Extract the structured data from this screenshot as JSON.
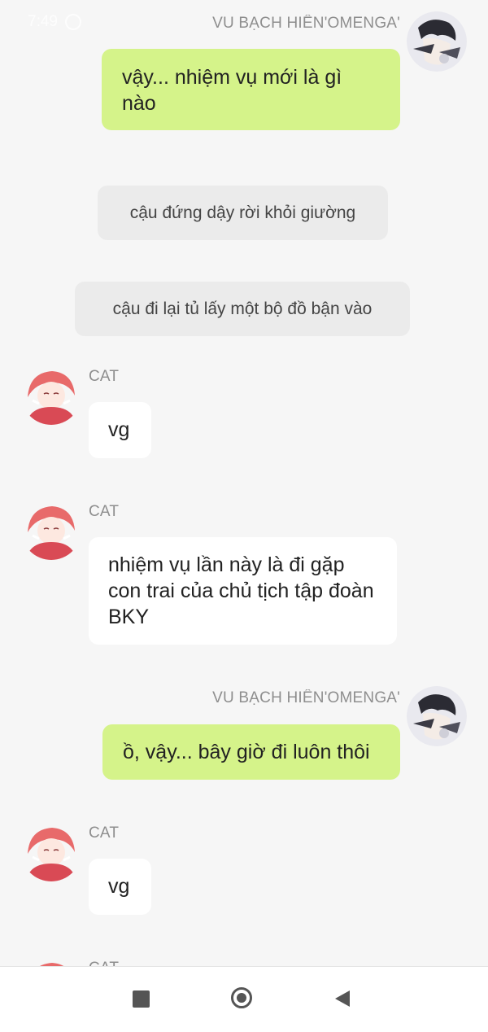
{
  "status_bar": {
    "time": "7:49"
  },
  "messages": {
    "m1": {
      "sender": "VU BẠCH HIÊN'OMENGA'",
      "text": "vậy... nhiệm vụ mới là gì nào"
    },
    "n1": {
      "text": "cậu đứng dậy rời khỏi giường"
    },
    "n2": {
      "text": "cậu đi lại tủ lấy một bộ đồ bận vào"
    },
    "c1": {
      "sender": "CAT",
      "text": "vg"
    },
    "c2": {
      "sender": "CAT",
      "text": "nhiệm vụ lần này là đi gặp con trai của chủ tịch tập đoàn BKY"
    },
    "m2": {
      "sender": "VU BẠCH HIÊN'OMENGA'",
      "text": "ồ, vậy... bây giờ đi luôn thôi"
    },
    "c3": {
      "sender": "CAT",
      "text": "vg"
    },
    "c4": {
      "sender": "CAT"
    }
  },
  "colors": {
    "my_bubble": "#d5f38a",
    "cat_bubble": "#ffffff",
    "narration_bubble": "#ebebeb",
    "background": "#f6f6f6"
  },
  "icons": {
    "recents": "square-icon",
    "home": "circle-icon",
    "back": "triangle-back-icon"
  }
}
